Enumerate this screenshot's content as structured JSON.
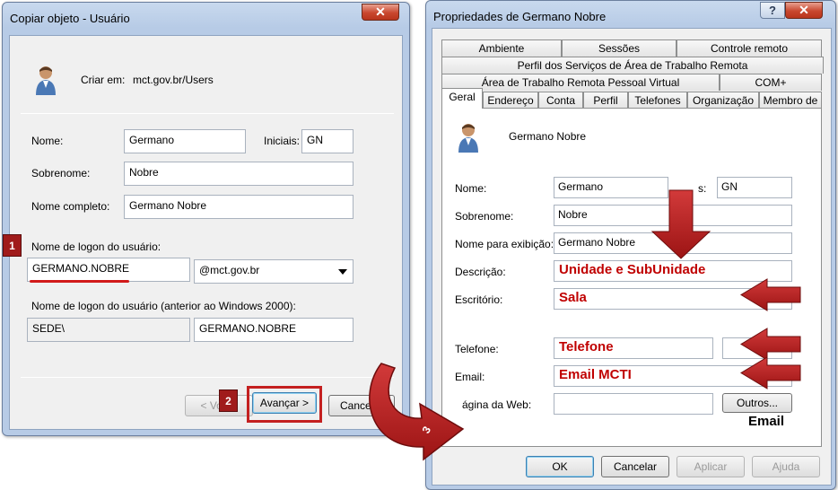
{
  "copy_dialog": {
    "title": "Copiar objeto - Usuário",
    "close_glyph": "✕",
    "create_in_label": "Criar em:",
    "create_in_value": "mct.gov.br/Users",
    "first_name_label": "Nome:",
    "first_name_value": "Germano",
    "initials_label": "Iniciais:",
    "initials_value": "GN",
    "last_name_label": "Sobrenome:",
    "last_name_value": "Nobre",
    "full_name_label": "Nome completo:",
    "full_name_value": "Germano Nobre",
    "logon_label": "Nome de logon do usuário:",
    "logon_value": "GERMANO.NOBRE",
    "domain_value": "@mct.gov.br",
    "pre2000_label": "Nome de logon do usuário (anterior ao Windows 2000):",
    "pre2000_domain": "SEDE\\",
    "pre2000_value": "GERMANO.NOBRE",
    "back_button": "< Voltar",
    "next_button": "Avançar >",
    "cancel_button": "Cancelar"
  },
  "callouts": {
    "step1": "1",
    "step2": "2",
    "step3": "3"
  },
  "props_dialog": {
    "title": "Propriedades de Germano Nobre",
    "help_glyph": "?",
    "close_glyph": "✕",
    "tabs_row1": [
      "Ambiente",
      "Sessões",
      "Controle remoto"
    ],
    "tabs_row2": [
      "Perfil dos Serviços de Área de Trabalho Remota"
    ],
    "tabs_row3": [
      "Área de Trabalho Remota Pessoal Virtual",
      "COM+"
    ],
    "tabs_row4": [
      "Geral",
      "Endereço",
      "Conta",
      "Perfil",
      "Telefones",
      "Organização",
      "Membro de"
    ],
    "display_header": "Germano Nobre",
    "first_name_label": "Nome:",
    "first_name_value": "Germano",
    "initials_label": "s:",
    "initials_value": "GN",
    "last_name_label": "Sobrenome:",
    "last_name_value": "Nobre",
    "display_name_label": "Nome para exibição:",
    "display_name_value": "Germano Nobre",
    "description_label": "Descrição:",
    "description_value": "Unidade e SubUnidade",
    "office_label": "Escritório:",
    "office_value": "Sala",
    "phone_label": "Telefone:",
    "phone_value": "Telefone",
    "email_label": "Email:",
    "email_value": "Email MCTI",
    "webpage_label": "ágina da Web:",
    "others_button": "Outros...",
    "email_note": "Email",
    "ok_button": "OK",
    "cancel_button": "Cancelar",
    "apply_button": "Aplicar",
    "help_button": "Ajuda"
  },
  "colors": {
    "annotation": "#c00000",
    "callout": "#a01b1b",
    "underline": "#d11a1a"
  }
}
